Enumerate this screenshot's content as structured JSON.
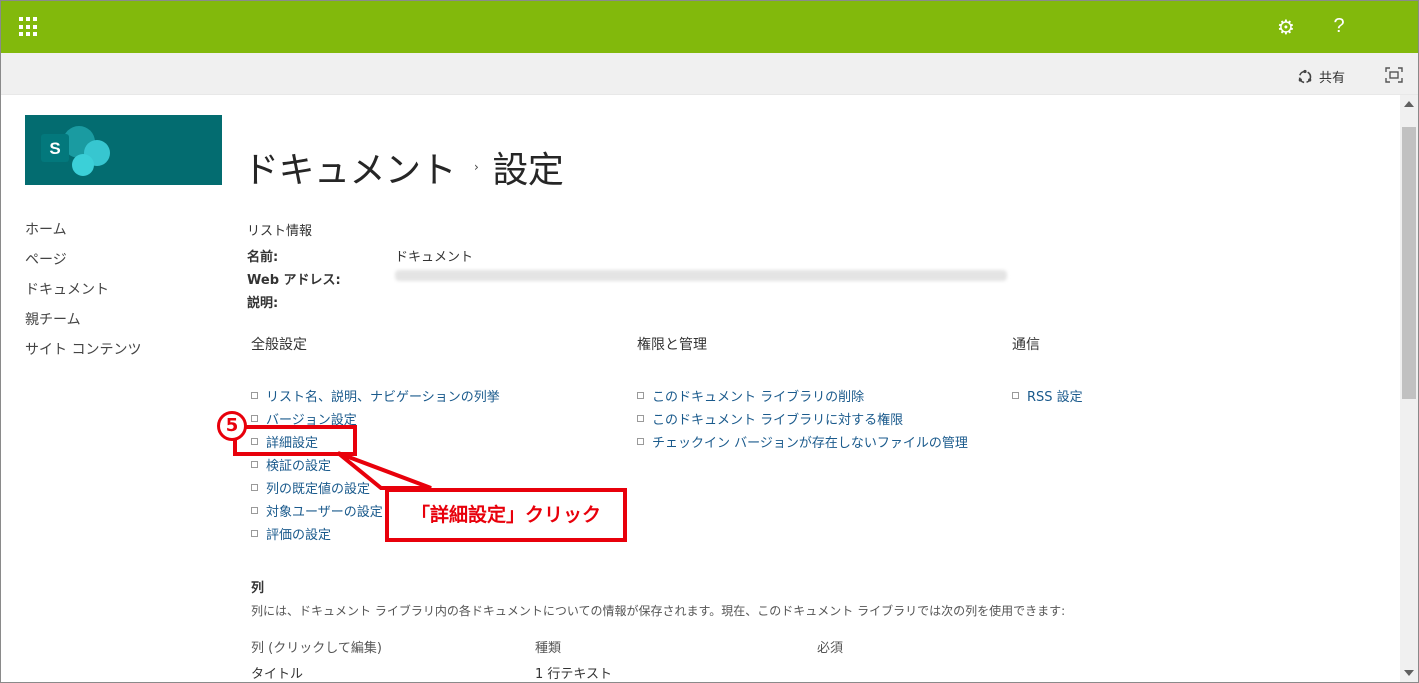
{
  "suitebar": {
    "bg": "#82b90c",
    "waffle_icon": "waffle-icon",
    "gear_icon": "gear-icon",
    "help_label": "?"
  },
  "commandbar": {
    "share_label": "共有",
    "share_icon": "share-icon",
    "focus_icon": "focus-mode-icon"
  },
  "site": {
    "logo_letter": "S"
  },
  "leftnav": [
    "ホーム",
    "ページ",
    "ドキュメント",
    "親チーム",
    "サイト コンテンツ"
  ],
  "title": {
    "part1": "ドキュメント",
    "separator": "›",
    "part2": "設定"
  },
  "list_info": {
    "heading": "リスト情報",
    "name_label": "名前:",
    "name_value": "ドキュメント",
    "web_label": "Web アドレス:",
    "desc_label": "説明:"
  },
  "general": {
    "heading": "全般設定",
    "links": [
      "リスト名、説明、ナビゲーションの列挙",
      "バージョン設定",
      "詳細設定",
      "検証の設定",
      "列の既定値の設定",
      "対象ユーザーの設定",
      "評価の設定"
    ]
  },
  "permissions": {
    "heading": "権限と管理",
    "links": [
      "このドキュメント ライブラリの削除",
      "このドキュメント ライブラリに対する権限",
      "チェックイン バージョンが存在しないファイルの管理"
    ]
  },
  "communication": {
    "heading": "通信",
    "links": [
      "RSS 設定"
    ]
  },
  "annotation": {
    "step": "5",
    "callout": "「詳細設定」クリック",
    "color": "#e8000b"
  },
  "columns": {
    "heading": "列",
    "description": "列には、ドキュメント ライブラリ内の各ドキュメントについての情報が保存されます。現在、このドキュメント ライブラリでは次の列を使用できます:",
    "headers": [
      "列 (クリックして編集)",
      "種類",
      "必須"
    ],
    "rows": [
      [
        "タイトル",
        "1 行テキスト",
        ""
      ]
    ]
  }
}
